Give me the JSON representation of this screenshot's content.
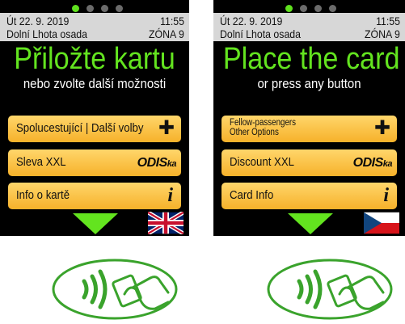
{
  "panels": [
    {
      "date": "Út 22. 9. 2019",
      "time": "11:55",
      "stop": "Dolní Lhota osada",
      "zone": "ZÓNA 9",
      "headline": "Přiložte kartu",
      "subline": "nebo zvolte další možnosti",
      "buttons": {
        "options": {
          "label": "Spolucestující | Další volby",
          "icon": "plus-icon"
        },
        "discount": {
          "label": "Sleva XXL",
          "logo_text": "ODIS",
          "logo_suffix": "ka"
        },
        "card_info": {
          "label": "Info o kartě",
          "icon": "info-icon"
        }
      },
      "language_flag": "uk-flag-icon"
    },
    {
      "date": "Út 22. 9. 2019",
      "time": "11:55",
      "stop": "Dolní Lhota osada",
      "zone": "ZÓNA 9",
      "headline": "Place the card",
      "subline": "or press any button",
      "buttons": {
        "options": {
          "label_line1": "Fellow-passengers",
          "label_line2": "Other Options",
          "icon": "plus-icon"
        },
        "discount": {
          "label": "Discount XXL",
          "logo_text": "ODIS",
          "logo_suffix": "ka"
        },
        "card_info": {
          "label": "Card Info",
          "icon": "info-icon"
        }
      },
      "language_flag": "czech-flag-icon"
    }
  ],
  "page_indicator": {
    "pages": 4,
    "active": 1
  },
  "colors": {
    "accent": "#63e41f",
    "button": "#f6b12a",
    "screen": "#000000",
    "status": "#d7d7d7"
  }
}
